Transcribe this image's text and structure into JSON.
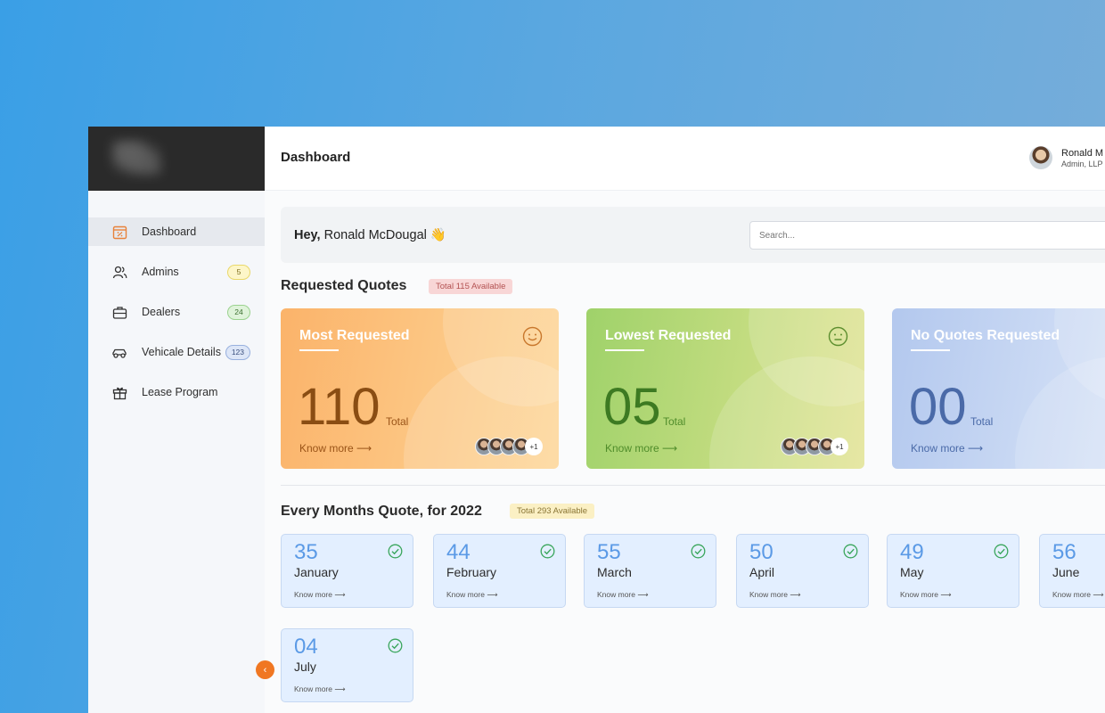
{
  "sidebar": {
    "items": [
      {
        "label": "Dashboard",
        "icon": "calendar-percent-icon",
        "active": true
      },
      {
        "label": "Admins",
        "icon": "users-icon",
        "badge": "5"
      },
      {
        "label": "Dealers",
        "icon": "briefcase-icon",
        "badge": "24"
      },
      {
        "label": "Vehicale Details",
        "icon": "car-icon",
        "badge": "123"
      },
      {
        "label": "Lease Program",
        "icon": "gift-icon"
      }
    ]
  },
  "header": {
    "title": "Dashboard",
    "user": {
      "name": "Ronald M",
      "role": "Admin, LLP"
    }
  },
  "greeting": {
    "prefix": "Hey,",
    "name": "Ronald McDougal",
    "emoji": "👋"
  },
  "search": {
    "placeholder": "Search..."
  },
  "requested_quotes": {
    "title": "Requested Quotes",
    "pill": "Total 115 Available",
    "cards": [
      {
        "title": "Most Requested",
        "value": "110",
        "total_label": "Total",
        "link": "Know more",
        "arrow": "⟶",
        "face": "smile-face-icon",
        "avatars_extra": "+1",
        "color": "#fbb36a"
      },
      {
        "title": "Lowest Requested",
        "value": "05",
        "total_label": "Total",
        "link": "Know more",
        "arrow": "⟶",
        "face": "neutral-face-icon",
        "avatars_extra": "+1",
        "color": "#9fd26a"
      },
      {
        "title": "No Quotes Requested",
        "value": "00",
        "total_label": "Total",
        "link": "Know more",
        "arrow": "⟶",
        "color": "#b3c8ee"
      }
    ]
  },
  "monthly": {
    "title": "Every Months Quote, for 2022",
    "pill": "Total 293 Available",
    "link": "Know more",
    "arrow": "⟶",
    "months": [
      {
        "value": "35",
        "month": "January"
      },
      {
        "value": "44",
        "month": "February"
      },
      {
        "value": "55",
        "month": "March"
      },
      {
        "value": "50",
        "month": "April"
      },
      {
        "value": "49",
        "month": "May"
      },
      {
        "value": "56",
        "month": "June"
      },
      {
        "value": "04",
        "month": "July"
      }
    ]
  },
  "collapse": {
    "glyph": "‹"
  }
}
